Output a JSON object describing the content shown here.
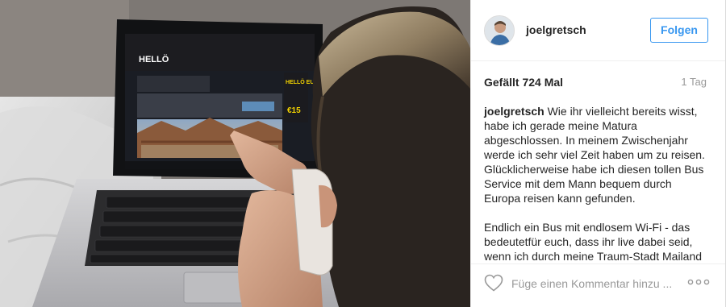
{
  "post": {
    "photo": {
      "description_icon": "photo-icon",
      "screen_logo": "HELLÖ",
      "screen_promo": "HELLÖ EURO",
      "screen_price": "€15"
    },
    "header": {
      "username": "joelgretsch",
      "follow_label": "Folgen"
    },
    "likes": "Gefällt 724 Mal",
    "time": "1 Tag",
    "caption": {
      "user": "joelgretsch",
      "paragraph1": " Wie ihr vielleicht bereits wisst, habe ich gerade meine Matura abgeschlossen. In meinem Zwischenjahr werde ich sehr viel Zeit haben um zu reisen. Glücklicherweise habe ich diesen tollen Bus Service mit dem Mann bequem durch Europa reisen kann gefunden.",
      "paragraph2": "Endlich ein Bus mit endlosem Wi-Fi - das bedeutetfür euch, dass ihr live dabei seid, wenn ich durch meine Traum-Stadt Mailand"
    },
    "comment": {
      "placeholder": "Füge einen Kommentar hinzu ..."
    },
    "icons": {
      "like": "heart-icon",
      "more": "more-options-icon"
    },
    "colors": {
      "accent": "#3897f0",
      "text": "#262626",
      "muted": "#999999"
    }
  }
}
